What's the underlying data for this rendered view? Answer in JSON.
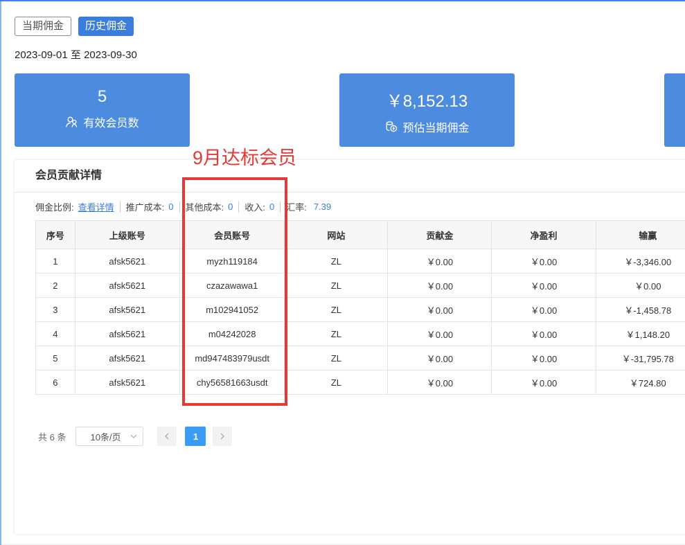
{
  "tabs": {
    "current": "当期佣金",
    "history": "历史佣金"
  },
  "date_range": "2023-09-01 至 2023-09-30",
  "cards": [
    {
      "value": "5",
      "label": "有效会员数",
      "icon": "users-icon"
    },
    {
      "value": "￥8,152.13",
      "label": "预估当期佣金",
      "icon": "coins-icon"
    }
  ],
  "annotation": "9月达标会员",
  "panel": {
    "title": "会员贡献详情",
    "stats": {
      "ratio_label": "佣金比例:",
      "ratio_link": "查看详情",
      "promo_label": "推广成本:",
      "promo_value": "0",
      "other_label": "其他成本:",
      "other_value": "0",
      "income_label": "收入:",
      "income_value": "0",
      "rate_label": "汇率:",
      "rate_value": "7.39"
    },
    "table": {
      "headers": [
        "序号",
        "上级账号",
        "会员账号",
        "网站",
        "贡献金",
        "净盈利",
        "输赢"
      ],
      "rows": [
        [
          "1",
          "afsk5621",
          "myzh119184",
          "ZL",
          "￥0.00",
          "￥0.00",
          "￥-3,346.00"
        ],
        [
          "2",
          "afsk5621",
          "czazawawa1",
          "ZL",
          "￥0.00",
          "￥0.00",
          "￥0.00"
        ],
        [
          "3",
          "afsk5621",
          "m102941052",
          "ZL",
          "￥0.00",
          "￥0.00",
          "￥-1,458.78"
        ],
        [
          "4",
          "afsk5621",
          "m04242028",
          "ZL",
          "￥0.00",
          "￥0.00",
          "￥1,148.20"
        ],
        [
          "5",
          "afsk5621",
          "md947483979usdt",
          "ZL",
          "￥0.00",
          "￥0.00",
          "￥-31,795.78"
        ],
        [
          "6",
          "afsk5621",
          "chy56581663usdt",
          "ZL",
          "￥0.00",
          "￥0.00",
          "￥724.80"
        ]
      ]
    },
    "pager": {
      "total": "共 6 条",
      "page_size": "10条/页",
      "current_page": "1"
    }
  }
}
